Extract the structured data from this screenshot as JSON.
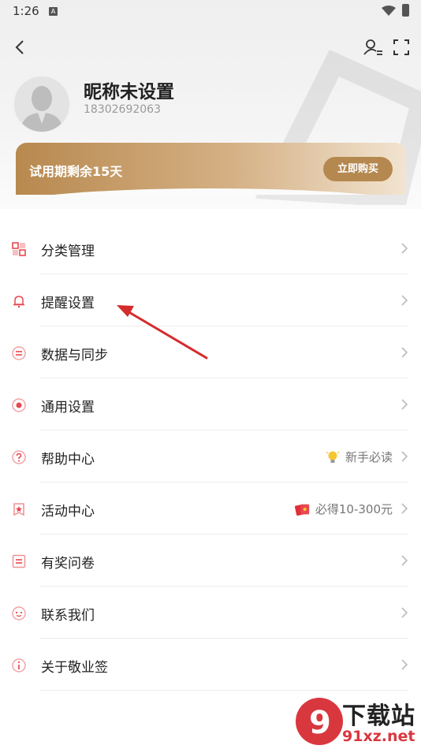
{
  "status_bar": {
    "time": "1:26",
    "notification_icon": "A"
  },
  "header": {
    "back_icon": "chevron-left-icon",
    "user_settings_icon": "user-settings-icon",
    "fullscreen_icon": "fullscreen-icon"
  },
  "profile": {
    "nickname": "昵称未设置",
    "phone": "18302692063"
  },
  "trial": {
    "text": "试用期剩余15天",
    "button_label": "立即购买"
  },
  "menu": [
    {
      "label": "分类管理",
      "icon": "category-icon"
    },
    {
      "label": "提醒设置",
      "icon": "bell-icon"
    },
    {
      "label": "数据与同步",
      "icon": "sync-icon"
    },
    {
      "label": "通用设置",
      "icon": "general-settings-icon"
    },
    {
      "label": "帮助中心",
      "icon": "help-icon",
      "extra": "新手必读",
      "extra_icon": "lightbulb-icon"
    },
    {
      "label": "活动中心",
      "icon": "activity-icon",
      "extra": "必得10-300元",
      "extra_icon": "red-envelope-icon"
    },
    {
      "label": "有奖问卷",
      "icon": "survey-icon"
    },
    {
      "label": "联系我们",
      "icon": "contact-icon"
    },
    {
      "label": "关于敬业签",
      "icon": "info-icon"
    }
  ],
  "watermark": {
    "line1": "下载站",
    "line2": "91xz.net",
    "logo_text": "9"
  },
  "colors": {
    "accent_red": "#e8484f",
    "gold_dark": "#b5884f",
    "gold_light": "#f2e4d1"
  }
}
